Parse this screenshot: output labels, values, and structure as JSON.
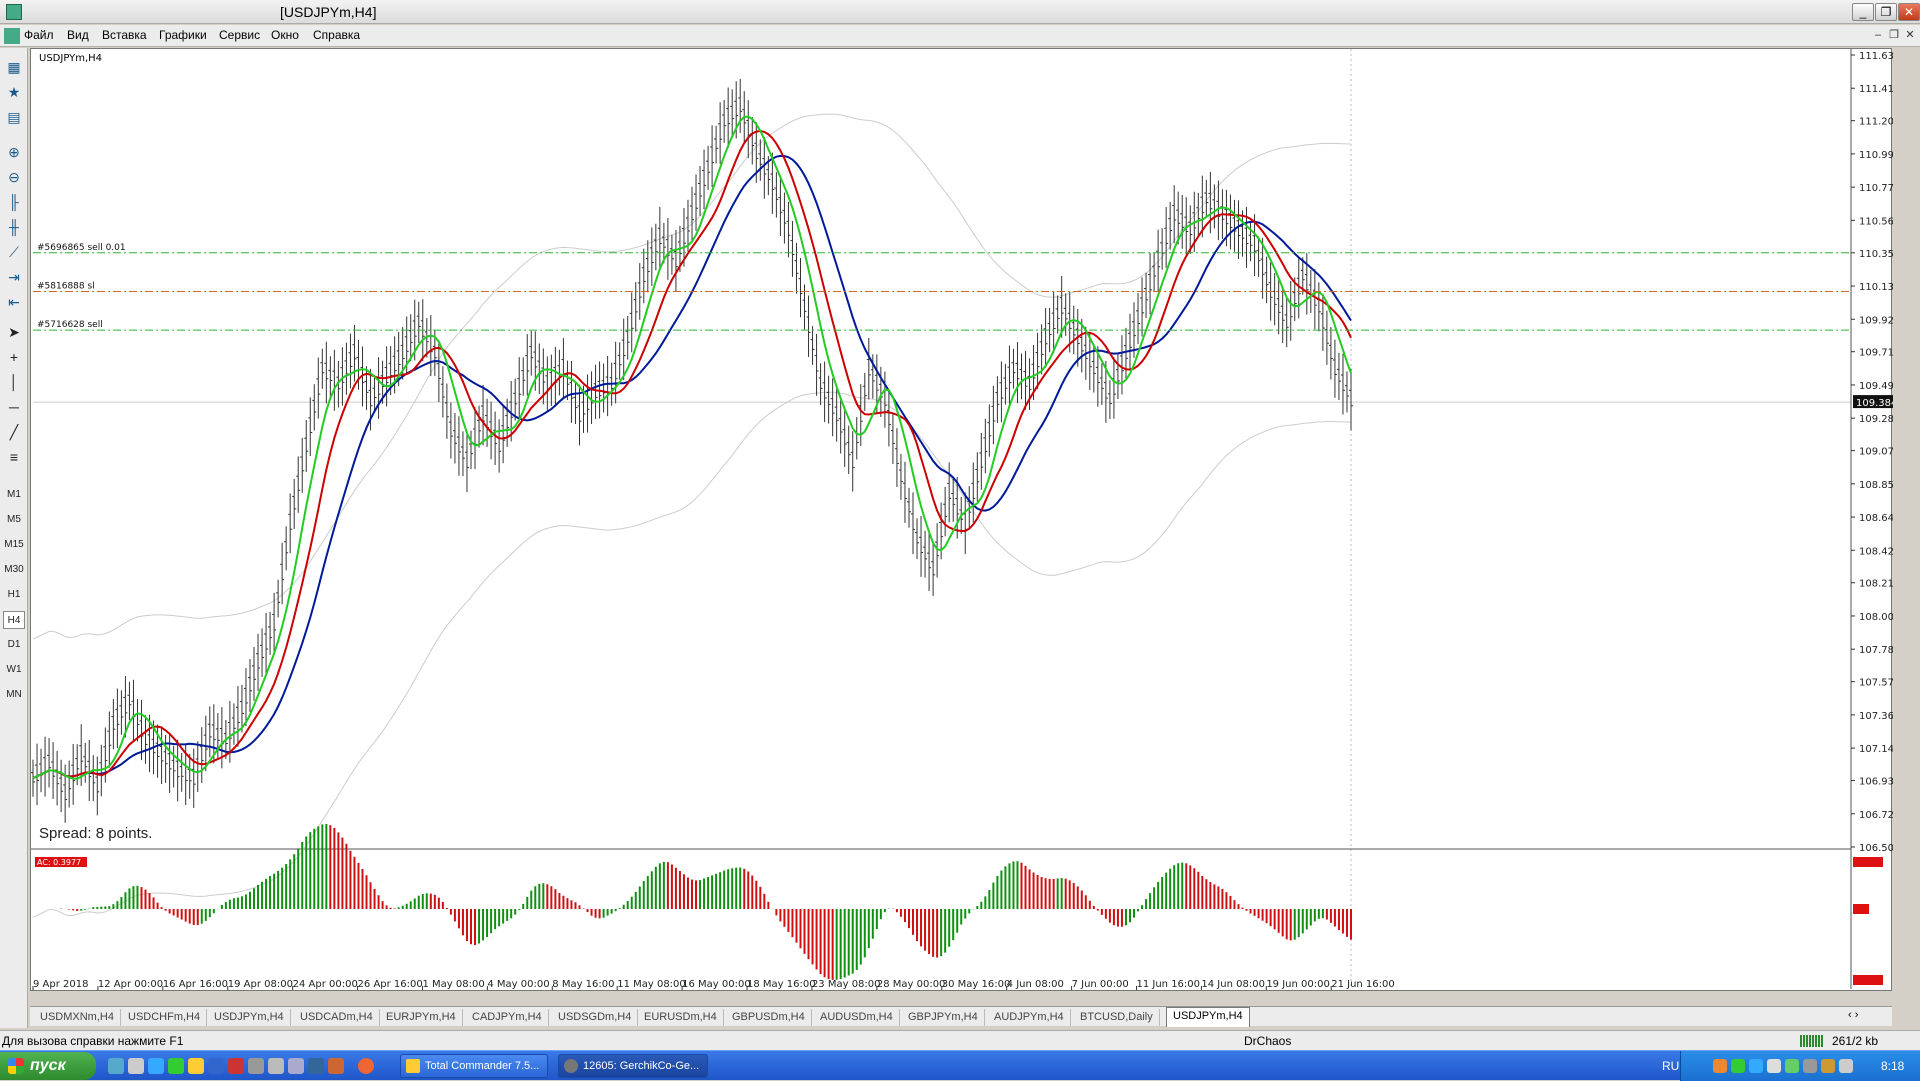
{
  "window": {
    "title": "[USDJPYm,H4]",
    "buttons": {
      "minimize": "_",
      "restore": "❐",
      "close": "✕"
    }
  },
  "menu": [
    "Файл",
    "Вид",
    "Вставка",
    "Графики",
    "Сервис",
    "Окно",
    "Справка"
  ],
  "timeframes": [
    "M1",
    "M5",
    "M15",
    "M30",
    "H1",
    "H4",
    "D1",
    "W1",
    "MN"
  ],
  "active_timeframe": "H4",
  "chart": {
    "symbol_label": "USDJPYm,H4",
    "spread_text": "Spread: 8 points.",
    "current_price": "109.384",
    "order_lines": [
      {
        "label": "#5696865 sell 0.01",
        "price": 110.35,
        "color": "#2db52d"
      },
      {
        "label": "#5816888 sl",
        "price": 110.1,
        "color": "#d2691e"
      },
      {
        "label": "#5716628 sell",
        "price": 109.85,
        "color": "#2db52d"
      }
    ],
    "indicator_label": "AC: 0.3977"
  },
  "chart_data": {
    "type": "candlestick",
    "y_ticks": [
      "111.630",
      "111.415",
      "111.205",
      "110.990",
      "110.775",
      "110.560",
      "110.350",
      "110.135",
      "109.920",
      "109.710",
      "109.495",
      "109.280",
      "109.070",
      "108.855",
      "108.640",
      "108.425",
      "108.215",
      "108.000",
      "107.785",
      "107.575",
      "107.360",
      "107.145",
      "106.935",
      "106.720",
      "106.505"
    ],
    "x_ticks": [
      "9 Apr 2018",
      "12 Apr 00:00",
      "16 Apr 16:00",
      "19 Apr 08:00",
      "24 Apr 00:00",
      "26 Apr 16:00",
      "1 May 08:00",
      "4 May 00:00",
      "8 May 16:00",
      "11 May 08:00",
      "16 May 00:00",
      "18 May 16:00",
      "23 May 08:00",
      "28 May 00:00",
      "30 May 16:00",
      "4 Jun 08:00",
      "7 Jun 00:00",
      "11 Jun 16:00",
      "14 Jun 08:00",
      "19 Jun 00:00",
      "21 Jun 16:00"
    ],
    "y_range": [
      106.505,
      111.63
    ],
    "series": [
      {
        "name": "green",
        "color": "#22cc22"
      },
      {
        "name": "red",
        "color": "#cc0000"
      },
      {
        "name": "blue",
        "color": "#001a99"
      }
    ],
    "close_path": [
      106.95,
      107.05,
      106.85,
      107.1,
      106.9,
      107.3,
      107.45,
      107.2,
      107.1,
      107.0,
      106.95,
      107.25,
      107.2,
      107.4,
      107.7,
      107.95,
      108.6,
      109.1,
      109.6,
      109.5,
      109.7,
      109.4,
      109.55,
      109.7,
      109.9,
      109.7,
      109.2,
      109.0,
      109.3,
      109.1,
      109.4,
      109.7,
      109.5,
      109.6,
      109.3,
      109.45,
      109.5,
      109.8,
      110.2,
      110.45,
      110.3,
      110.6,
      110.9,
      111.2,
      111.3,
      111.0,
      110.8,
      110.5,
      110.0,
      109.5,
      109.3,
      109.0,
      109.6,
      109.4,
      108.9,
      108.5,
      108.3,
      108.8,
      108.6,
      109.0,
      109.4,
      109.6,
      109.5,
      109.8,
      110.0,
      109.8,
      109.6,
      109.4,
      109.7,
      110.0,
      110.3,
      110.6,
      110.5,
      110.7,
      110.6,
      110.5,
      110.4,
      110.1,
      109.9,
      110.2,
      110.0,
      109.6,
      109.4
    ]
  },
  "tabs": [
    "USDMXNm,H4",
    "USDCHFm,H4",
    "USDJPYm,H4",
    "USDCADm,H4",
    "EURJPYm,H4",
    "CADJPYm,H4",
    "USDSGDm,H4",
    "EURUSDm,H4",
    "GBPUSDm,H4",
    "AUDUSDm,H4",
    "GBPJPYm,H4",
    "AUDJPYm,H4",
    "BTCUSD,Daily",
    "USDJPYm,H4"
  ],
  "active_tab": 13,
  "status": {
    "help": "Для вызова справки нажмите F1",
    "profile": "DrChaos",
    "traffic": "261/2 kb"
  },
  "taskbar": {
    "start": "пуск",
    "items": [
      "Total Commander 7.5...",
      "12605: GerchikCo-Ge..."
    ],
    "lang": "RU",
    "clock": "8:18"
  }
}
